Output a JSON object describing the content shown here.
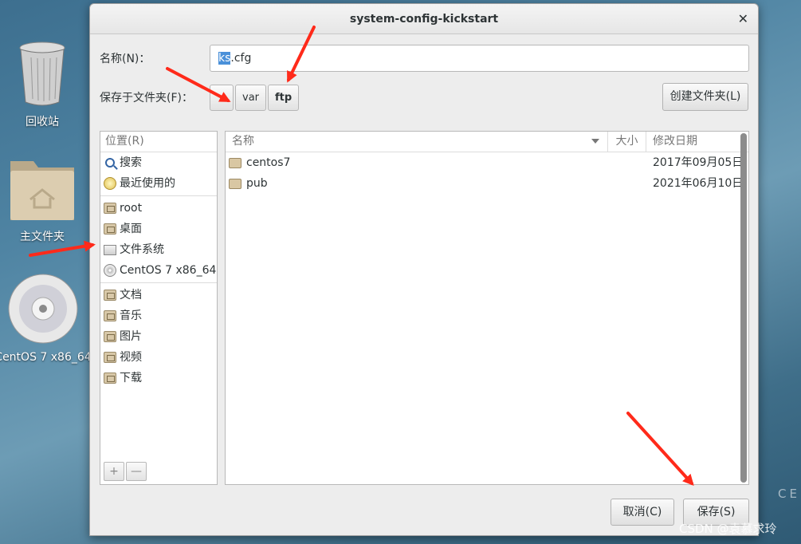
{
  "desktop": {
    "trash_label": "回收站",
    "home_label": "主文件夹",
    "cdrom_label": "CentOS 7 x86_64"
  },
  "dialog": {
    "title": "system-config-kickstart",
    "name_label": "名称(N)：",
    "filename_selected": "ks",
    "filename_rest": ".cfg",
    "folder_label": "保存于文件夹(F)：",
    "path": [
      "var",
      "ftp"
    ],
    "create_folder": "创建文件夹(L)",
    "cancel": "取消(C)",
    "save": "保存(S)"
  },
  "places": {
    "header": "位置(R)",
    "items": [
      {
        "label": "搜索",
        "icon": "search-icon"
      },
      {
        "label": "最近使用的",
        "icon": "recent-icon"
      },
      {
        "label": "root",
        "icon": "home-folder-icon"
      },
      {
        "label": "桌面",
        "icon": "desktop-folder-icon"
      },
      {
        "label": "文件系统",
        "icon": "filesystem-icon"
      },
      {
        "label": "CentOS 7 x86_64",
        "icon": "disc-icon"
      },
      {
        "label": "文档",
        "icon": "documents-folder-icon"
      },
      {
        "label": "音乐",
        "icon": "music-folder-icon"
      },
      {
        "label": "图片",
        "icon": "pictures-folder-icon"
      },
      {
        "label": "视频",
        "icon": "videos-folder-icon"
      },
      {
        "label": "下载",
        "icon": "downloads-folder-icon"
      }
    ],
    "add": "+",
    "remove": "—"
  },
  "files": {
    "col_name": "名称",
    "col_size": "大小",
    "col_date": "修改日期",
    "rows": [
      {
        "name": "centos7",
        "size": "",
        "date": "2017年09月05日"
      },
      {
        "name": "pub",
        "size": "",
        "date": "2021年06月10日"
      }
    ]
  },
  "watermark": {
    "ce": "CE",
    "csdn": "CSDN @袁慕求玲"
  },
  "colors": {
    "arrow": "#ff2a1a",
    "selection": "#4a90d9"
  }
}
